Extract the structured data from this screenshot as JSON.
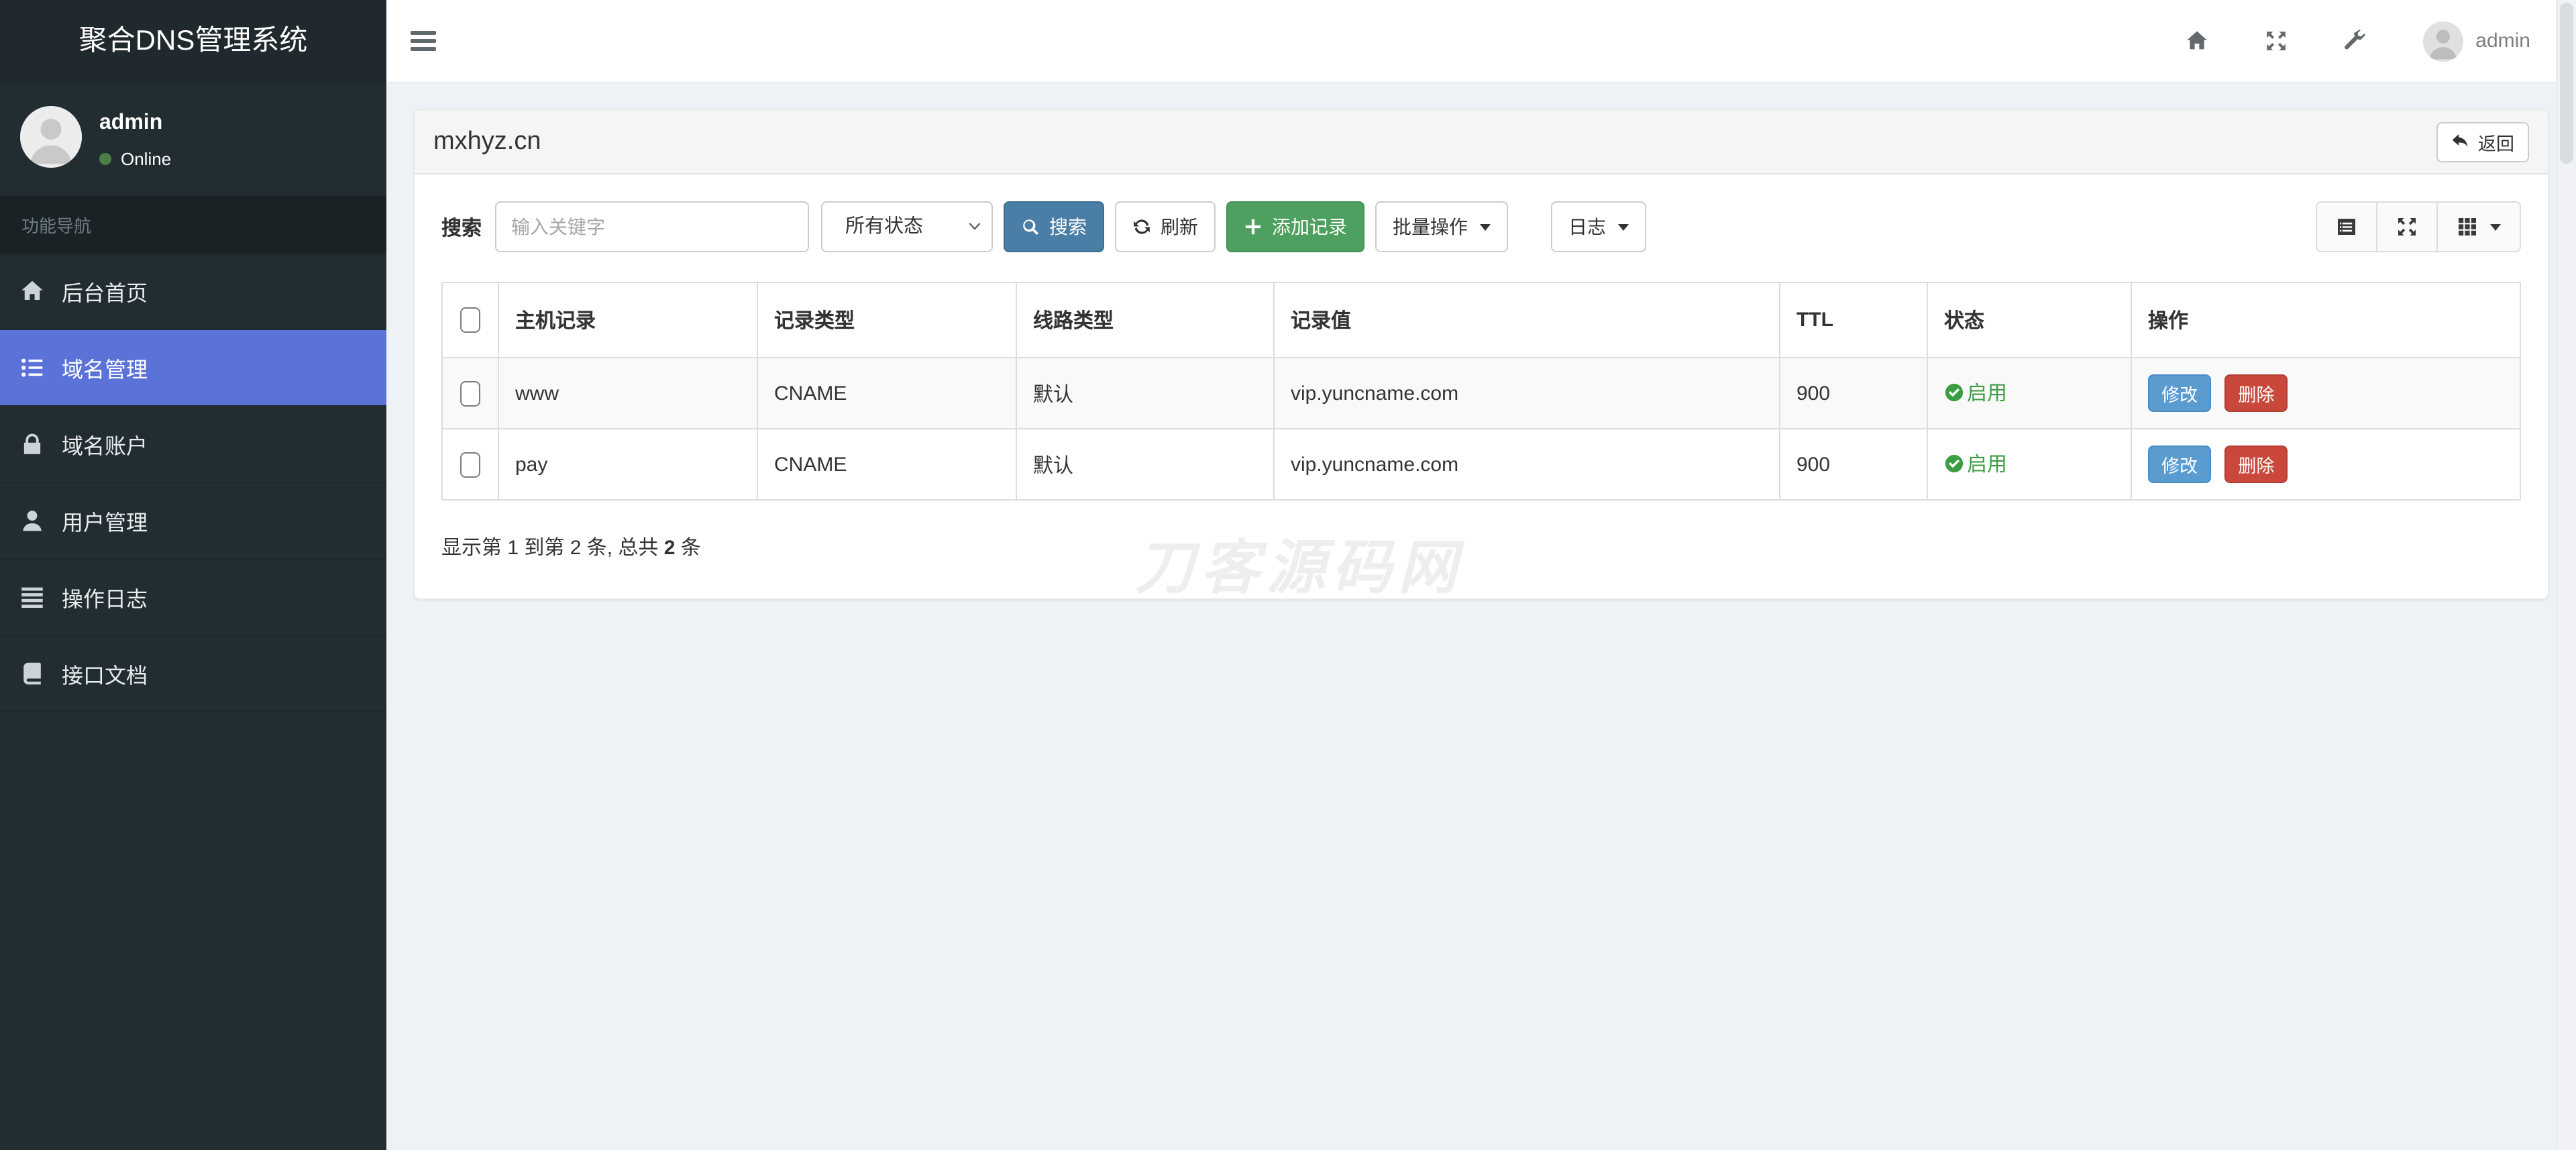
{
  "app": {
    "title": "聚合DNS管理系统"
  },
  "navbar": {
    "user": "admin",
    "icons": [
      "home-icon",
      "fullscreen-icon",
      "wrench-icon"
    ]
  },
  "sidebar": {
    "user": {
      "name": "admin",
      "status": "Online"
    },
    "section_label": "功能导航",
    "items": [
      {
        "label": "后台首页",
        "icon": "home",
        "active": false
      },
      {
        "label": "域名管理",
        "icon": "list-ul",
        "active": true
      },
      {
        "label": "域名账户",
        "icon": "lock",
        "active": false
      },
      {
        "label": "用户管理",
        "icon": "user",
        "active": false
      },
      {
        "label": "操作日志",
        "icon": "th-list",
        "active": false
      },
      {
        "label": "接口文档",
        "icon": "book",
        "active": false
      }
    ]
  },
  "page": {
    "title": "mxhyz.cn",
    "back_button": "返回",
    "toolbar": {
      "search_label": "搜索",
      "search_placeholder": "输入关键字",
      "search_value": "",
      "status_filter_selected": "所有状态",
      "search_button": "搜索",
      "refresh_button": "刷新",
      "add_button": "添加记录",
      "bulk_button": "批量操作",
      "log_button": "日志",
      "view_icons": [
        "list-alt-icon",
        "expand-icon",
        "grid-icon"
      ]
    },
    "table": {
      "columns": [
        "主机记录",
        "记录类型",
        "线路类型",
        "记录值",
        "TTL",
        "状态",
        "操作"
      ],
      "rows": [
        {
          "host": "www",
          "type": "CNAME",
          "line": "默认",
          "value": "vip.yuncname.com",
          "ttl": "900",
          "status": "启用"
        },
        {
          "host": "pay",
          "type": "CNAME",
          "line": "默认",
          "value": "vip.yuncname.com",
          "ttl": "900",
          "status": "启用"
        }
      ],
      "actions": {
        "edit": "修改",
        "delete": "删除"
      }
    },
    "pagination": {
      "prefix": "显示第 1 到第 2 条, 总共 ",
      "total": "2",
      "suffix": " 条"
    },
    "watermark": "刀客源码网"
  },
  "colors": {
    "accent_active": "#5b73d8",
    "primary_btn": "#4a7ea6",
    "success_btn": "#4da05f",
    "edit_btn": "#5a9bd0",
    "delete_btn": "#c9473b",
    "status_enabled": "#3c9e42",
    "sidebar_bg": "#222d32",
    "content_bg": "#eef1f6"
  }
}
